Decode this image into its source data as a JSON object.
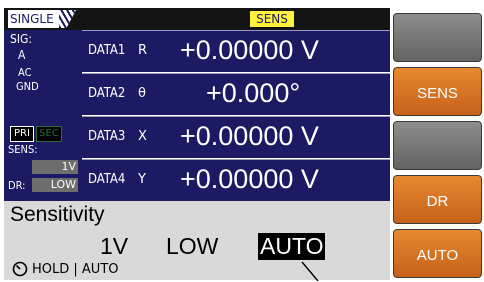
{
  "header": {
    "mode": "SINGLE",
    "sens_badge": "SENS"
  },
  "left_panel": {
    "sig_label": "SIG:",
    "sig_values": [
      "A",
      "AC",
      "GND"
    ],
    "pri_label": "PRI",
    "sec_label": "SEC",
    "sens_label": "SENS:",
    "sens_value": "1V",
    "dr_label": "DR:",
    "dr_value": "LOW"
  },
  "data_rows": [
    {
      "label": "DATA1",
      "symbol": "R",
      "value": "+0.00000 V"
    },
    {
      "label": "DATA2",
      "symbol": "θ",
      "value": "+0.000°"
    },
    {
      "label": "DATA3",
      "symbol": "X",
      "value": "+0.00000 V"
    },
    {
      "label": "DATA4",
      "symbol": "Y",
      "value": "+0.00000 V"
    }
  ],
  "bottom_info": {
    "title": "Sensitivity",
    "options": [
      "1V",
      "LOW",
      "AUTO"
    ],
    "selected": "AUTO",
    "hint": "HOLD | AUTO"
  },
  "softkeys": [
    {
      "label": "",
      "color": "#7a7a7a"
    },
    {
      "label": "SENS",
      "color": "#d9752a"
    },
    {
      "label": "",
      "color": "#7a7a7a"
    },
    {
      "label": "DR",
      "color": "#d9752a"
    },
    {
      "label": "AUTO",
      "color": "#d9752a"
    }
  ],
  "colors": {
    "panel_bg": "#1b1a62",
    "accent_yellow": "#fff23a",
    "softkey_orange": "#d9752a",
    "softkey_grey": "#7a7a7a",
    "info_bg": "#d9d9d9"
  }
}
